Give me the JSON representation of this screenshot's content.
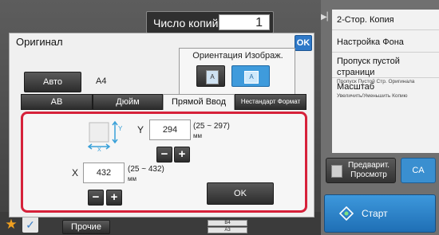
{
  "copies": {
    "label": "Число копий",
    "value": "1"
  },
  "dialog": {
    "title": "Оригинал",
    "ok_label": "OK",
    "orientation": {
      "label": "Ориентация Изображ.",
      "portrait_glyph": "A",
      "landscape_glyph": "A"
    },
    "auto_label": "Авто",
    "paper_size": "A4",
    "tabs": [
      {
        "label": "AB"
      },
      {
        "label": "Дюйм"
      },
      {
        "label": "Прямой Ввод"
      },
      {
        "label": "Нестандарт Формат"
      }
    ],
    "direct_input": {
      "y_label": "Y",
      "y_value": "294",
      "y_range": "(25 ~ 297)",
      "y_unit": "мм",
      "x_label": "X",
      "x_value": "432",
      "x_range": "(25 ~ 432)",
      "x_unit": "мм",
      "minus": "−",
      "plus": "+",
      "ok_label": "OK"
    }
  },
  "right_menu": [
    {
      "title": "2-Стор. Копия",
      "sub": ""
    },
    {
      "title": "Настройка Фона",
      "sub": ""
    },
    {
      "title": "Пропуск пустой страници",
      "sub": "Пропуск Пустой Стр. Оригинала"
    },
    {
      "title": "Масштаб",
      "sub": "Увеличить/Уменьшить Копию"
    }
  ],
  "preview_label": "Предварит. Просмотр",
  "ca_label": "CA",
  "start_label": "Старт",
  "bottom": {
    "other_label": "Прочие",
    "tray_b4": "B4",
    "tray_a3": "A3"
  },
  "colors": {
    "accent_blue": "#2f79c8",
    "highlight_red": "#d6213a",
    "start_blue": "#2a84cc"
  }
}
